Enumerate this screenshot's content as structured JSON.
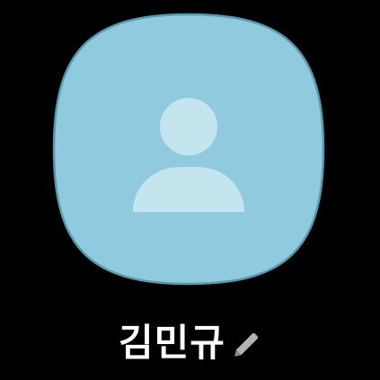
{
  "profile": {
    "name": "김민규",
    "avatar_icon": "person-icon",
    "edit_icon": "pencil-icon"
  },
  "colors": {
    "background": "#000000",
    "avatar_fill": "#8fcadf",
    "avatar_border": "#5a98ad",
    "person_glyph": "#c4e4ee",
    "name_text": "#ffffff",
    "edit_icon": "#b3b3b3"
  }
}
